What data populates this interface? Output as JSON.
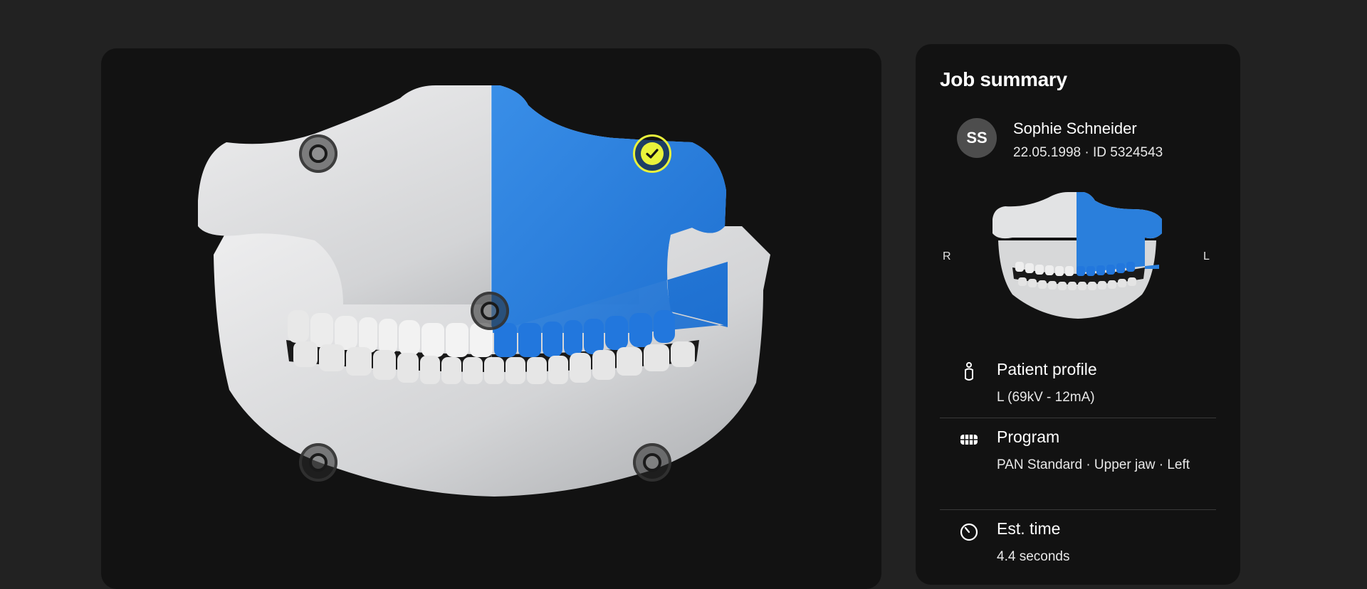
{
  "summary": {
    "title": "Job summary",
    "patient": {
      "initials": "SS",
      "name": "Sophie Schneider",
      "meta": "22.05.1998 · ID 5324543"
    },
    "orientation": {
      "right": "R",
      "left": "L"
    },
    "rows": [
      {
        "icon": "person-icon",
        "label": "Patient profile",
        "value": "L (69kV - 12mA)"
      },
      {
        "icon": "teeth-program-icon",
        "label": "Program",
        "value": "PAN  Standard  ·  Upper jaw  · Left"
      },
      {
        "icon": "stopwatch-icon",
        "label": "Est. time",
        "value": "4.4 seconds"
      }
    ]
  },
  "viewer": {
    "highlight_color": "#2a7fdc",
    "bone_color": "#d9dadb",
    "selected_color": "#e9f33b",
    "markers": [
      {
        "id": "upper-right",
        "selected": false
      },
      {
        "id": "upper-left",
        "selected": true
      },
      {
        "id": "center",
        "selected": false
      },
      {
        "id": "lower-right",
        "selected": false
      },
      {
        "id": "lower-left",
        "selected": false
      }
    ]
  }
}
